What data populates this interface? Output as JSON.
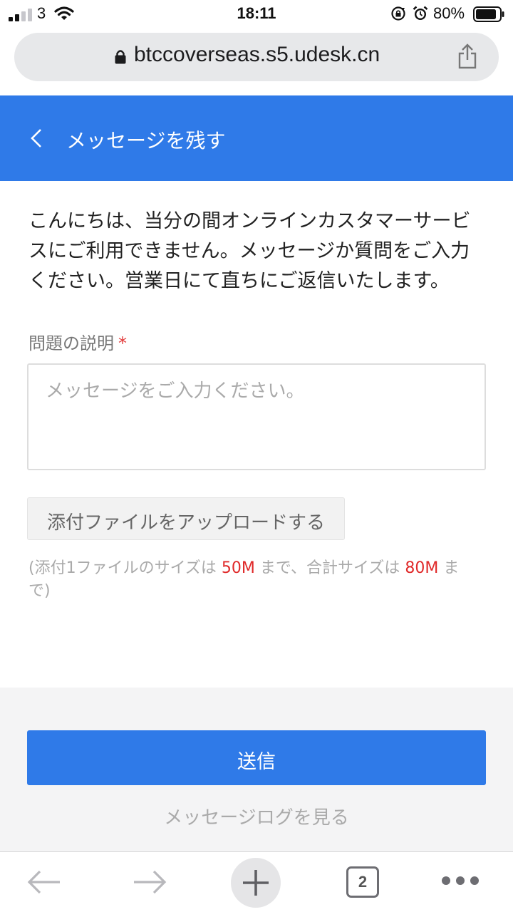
{
  "status_bar": {
    "carrier": "3",
    "time": "18:11",
    "battery": "80%"
  },
  "browser": {
    "url": "btccoverseas.s5.udesk.cn",
    "tab_count": "2"
  },
  "header": {
    "title": "メッセージを残す"
  },
  "intro": "こんにちは、当分の間オンラインカスタマーサービスにご利用できません。メッセージか質問をご入力ください。営業日にて直ちにご返信いたします。",
  "form": {
    "description_label": "問題の説明",
    "required_mark": "*",
    "description_placeholder": "メッセージをご入力ください。",
    "upload_label": "添付ファイルをアップロードする",
    "note": {
      "prefix": "(添付1ファイルのサイズは ",
      "single_limit": "50M",
      "middle": " まで、合計サイズは ",
      "total_limit": "80M",
      "suffix": " まで)"
    }
  },
  "footer": {
    "send_label": "送信",
    "log_link": "メッセージログを見る"
  },
  "colors": {
    "primary": "#2f7ae8",
    "accent_red": "#e02a2a"
  }
}
